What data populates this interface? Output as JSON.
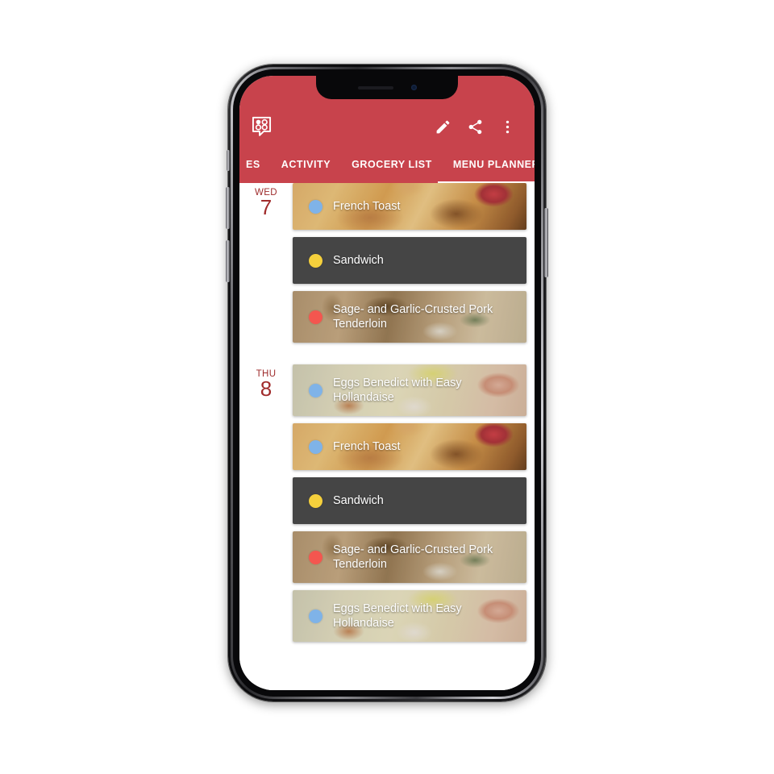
{
  "app": {
    "logo_icon": "recipe-bubble-logo-icon",
    "bar_color": "#c8434c",
    "actions": [
      {
        "name": "edit",
        "icon": "pencil-icon"
      },
      {
        "name": "share",
        "icon": "share-icon"
      },
      {
        "name": "overflow",
        "icon": "more-vertical-icon"
      }
    ]
  },
  "tabs": [
    {
      "label": "ES",
      "active": false,
      "partial": true
    },
    {
      "label": "ACTIVITY",
      "active": false,
      "partial": false
    },
    {
      "label": "GROCERY LIST",
      "active": false,
      "partial": false
    },
    {
      "label": "MENU PLANNER",
      "active": true,
      "partial": false
    }
  ],
  "meal_colors": {
    "breakfast": "#7fb3e8",
    "lunch": "#f5d03c",
    "dinner": "#f4564f"
  },
  "planner": {
    "days": [
      {
        "weekday": "WED",
        "number": "7",
        "meals": [
          {
            "title": "French Toast",
            "dot": "breakfast",
            "bg": "bg-frenchtoast",
            "tall": false
          },
          {
            "title": "Sandwich",
            "dot": "lunch",
            "bg": "plain",
            "tall": false
          },
          {
            "title": "Sage- and Garlic-Crusted Pork Tenderloin",
            "dot": "dinner",
            "bg": "bg-porktenderloin",
            "tall": true
          }
        ]
      },
      {
        "weekday": "THU",
        "number": "8",
        "meals": [
          {
            "title": "Eggs Benedict with Easy Hollandaise",
            "dot": "breakfast",
            "bg": "bg-eggsbenedict",
            "tall": true
          },
          {
            "title": "French Toast",
            "dot": "breakfast",
            "bg": "bg-frenchtoast",
            "tall": false
          },
          {
            "title": "Sandwich",
            "dot": "lunch",
            "bg": "plain",
            "tall": false
          },
          {
            "title": "Sage- and Garlic-Crusted Pork Tenderloin",
            "dot": "dinner",
            "bg": "bg-porktenderloin",
            "tall": true
          },
          {
            "title": "Eggs Benedict with Easy Hollandaise",
            "dot": "breakfast",
            "bg": "bg-eggsbenedict",
            "tall": true
          }
        ]
      }
    ]
  }
}
